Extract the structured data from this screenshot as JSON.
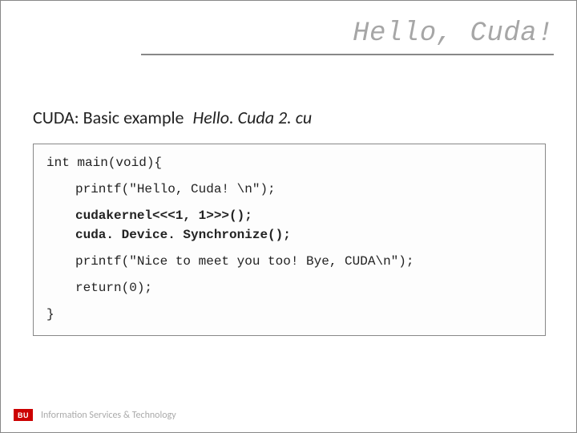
{
  "title": "Hello, Cuda!",
  "subtitle_label": "CUDA: Basic example",
  "subtitle_filename": "Hello. Cuda 2. cu",
  "code": {
    "line_signature": "int main(void){",
    "line_printf1": "printf(\"Hello, Cuda! \\n\");",
    "line_kernel": "cudakernel<<<1, 1>>>();",
    "line_sync": "cuda. Device. Synchronize();",
    "line_printf2": "printf(\"Nice to meet you too! Bye, CUDA\\n\");",
    "line_return": "return(0);",
    "line_close": "}"
  },
  "footer": {
    "logo_text": "BU",
    "org_text": "Information Services & Technology"
  }
}
